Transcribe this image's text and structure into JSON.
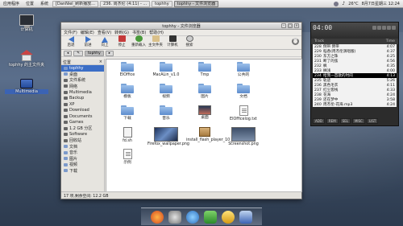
{
  "top_panel": {
    "menus": [
      "应用程序",
      "位置",
      "系统"
    ],
    "tasks": [
      "[DanNiel_刷新播放...",
      "236. 周杰伦 (4:11) - ...",
      "tophhy",
      "tophhy - 文件浏览器"
    ],
    "active_task_index": 3,
    "weather": "26°C",
    "datetime": "8月7日星期三 12:24"
  },
  "desktop_icons": [
    {
      "label": "计算机",
      "icon": "computer-icon"
    },
    {
      "label": "tophhy 的主文件夹",
      "icon": "home-folder-icon"
    },
    {
      "label": "Multimedia",
      "icon": "drive-icon"
    }
  ],
  "window": {
    "title": "tophhy - 文件浏览器",
    "menu": [
      "文件(F)",
      "编辑(E)",
      "查看(V)",
      "转到(G)",
      "书签(B)",
      "帮助(H)"
    ],
    "toolbar": [
      "后退",
      "前进",
      "向上",
      "停止",
      "重新载入",
      "主文件夹",
      "计算机",
      "搜索"
    ],
    "location_crumbs": [
      "tophhy"
    ],
    "sidebar_title": "位置",
    "sidebar_items": [
      {
        "label": "tophhy",
        "selected": true,
        "type": "folder"
      },
      {
        "label": "桌面",
        "type": "folder"
      },
      {
        "label": "文件系统",
        "type": "device"
      },
      {
        "label": "网络",
        "type": "device"
      },
      {
        "label": "Multimedia",
        "type": "device"
      },
      {
        "label": "Backup",
        "type": "device"
      },
      {
        "label": "XP",
        "type": "device"
      },
      {
        "label": "Download",
        "type": "device"
      },
      {
        "label": "Documents",
        "type": "device"
      },
      {
        "label": "Games",
        "type": "device"
      },
      {
        "label": "1.2 GB 分区",
        "type": "device"
      },
      {
        "label": "Software",
        "type": "device"
      },
      {
        "label": "回收站",
        "type": "device"
      },
      {
        "label": "文档",
        "type": "folder"
      },
      {
        "label": "音乐",
        "type": "folder"
      },
      {
        "label": "图片",
        "type": "folder"
      },
      {
        "label": "视频",
        "type": "folder"
      },
      {
        "label": "下载",
        "type": "folder"
      }
    ],
    "files": [
      {
        "name": "EIOffice",
        "kind": "folder"
      },
      {
        "name": "MacALin_v1.0",
        "kind": "folder"
      },
      {
        "name": "Tmp",
        "kind": "folder"
      },
      {
        "name": "公共的",
        "kind": "folder"
      },
      {
        "name": "",
        "kind": "empty"
      },
      {
        "name": "模板",
        "kind": "folder"
      },
      {
        "name": "视频",
        "kind": "folder"
      },
      {
        "name": "图片",
        "kind": "folder"
      },
      {
        "name": "文档",
        "kind": "folder"
      },
      {
        "name": "",
        "kind": "empty"
      },
      {
        "name": "下载",
        "kind": "folder"
      },
      {
        "name": "音乐",
        "kind": "folder"
      },
      {
        "name": "桌面",
        "kind": "desktop"
      },
      {
        "name": "EIOfficelog.txt",
        "kind": "doc"
      },
      {
        "name": "",
        "kind": "empty"
      },
      {
        "name": "fd.sh",
        "kind": "script"
      },
      {
        "name": "Firefox_wallpaper.png",
        "kind": "wallpaper"
      },
      {
        "name": "install_flash_player_10_linux.deb",
        "kind": "package"
      },
      {
        "name": "Screenshot.png",
        "kind": "screenshot"
      },
      {
        "name": "",
        "kind": "empty"
      },
      {
        "name": "示例",
        "kind": "doc"
      }
    ],
    "status": "17 项,剩余空间: 12.2 GB"
  },
  "player": {
    "time": "04:00",
    "columns": [
      "Track",
      "Time"
    ],
    "playlist": [
      {
        "n": "228",
        "title": "倒带 倒带",
        "time": "4:07"
      },
      {
        "n": "229",
        "title": "稻香(周杰伦演唱版)",
        "time": "4:37"
      },
      {
        "n": "230",
        "title": "东方之珠",
        "time": "4:25"
      },
      {
        "n": "231",
        "title": "断了的弦",
        "time": "4:56"
      },
      {
        "n": "232",
        "title": "枫",
        "time": "4:35"
      },
      {
        "n": "233",
        "title": "搁浅",
        "time": "4:00"
      },
      {
        "n": "234",
        "title": "给我一首歌的时间",
        "time": "4:13",
        "current": true
      },
      {
        "n": "235",
        "title": "轨迹",
        "time": "5:26"
      },
      {
        "n": "236",
        "title": "黑色毛衣",
        "time": "4:11"
      },
      {
        "n": "237",
        "title": "红尘客栈",
        "time": "4:33"
      },
      {
        "n": "238",
        "title": "花海",
        "time": "4:24"
      },
      {
        "n": "239",
        "title": "还在梦中",
        "time": "3:58"
      },
      {
        "n": "240",
        "title": "周杰伦-花海.mp3",
        "time": "4:24"
      }
    ],
    "buttons": [
      "ADD",
      "REM",
      "SEL",
      "MISC",
      "LIST"
    ]
  },
  "dock_items": [
    "firefox-icon",
    "disk-icon",
    "messenger-icon",
    "terminal-icon",
    "chat-icon",
    "files-icon"
  ]
}
